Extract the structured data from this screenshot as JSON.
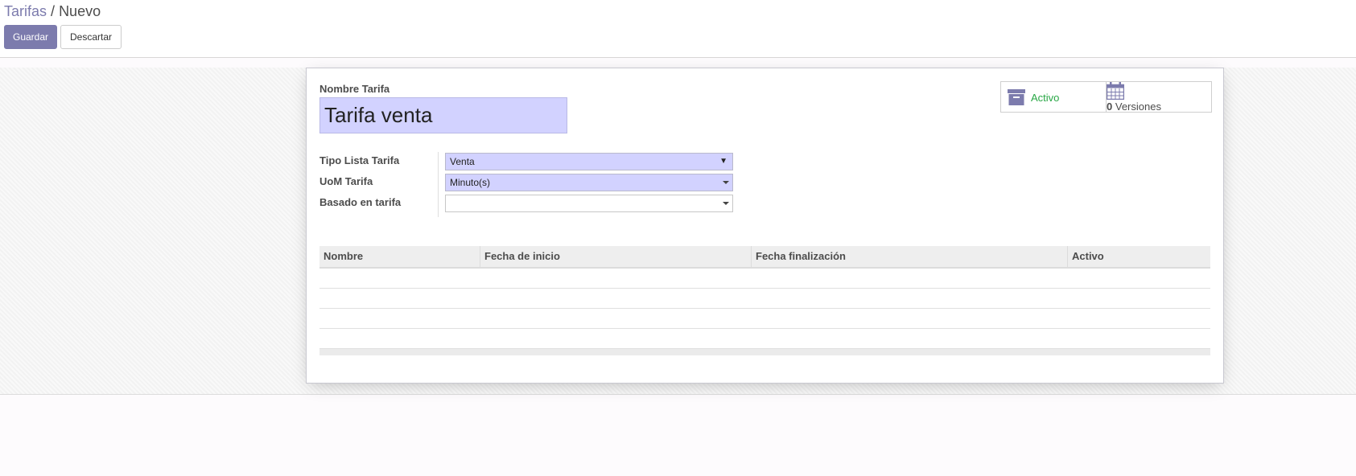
{
  "breadcrumb": {
    "parent": "Tarifas",
    "separator": "/",
    "current": "Nuevo"
  },
  "toolbar": {
    "save_label": "Guardar",
    "discard_label": "Descartar"
  },
  "form": {
    "name_label": "Nombre Tarifa",
    "name_value": "Tarifa venta",
    "smart_buttons": {
      "active_label": "Activo",
      "active_icon": "archive-icon",
      "versions_count": "0",
      "versions_label": "Versiones",
      "versions_icon": "calendar-icon"
    },
    "fields": [
      {
        "label": "Tipo Lista Tarifa",
        "value": "Venta"
      },
      {
        "label": "UoM Tarifa",
        "value": "Minuto(s)"
      },
      {
        "label": "Basado en tarifa",
        "value": ""
      }
    ],
    "table": {
      "columns": [
        "Nombre",
        "Fecha de inicio",
        "Fecha finalización",
        "Activo"
      ],
      "rows": []
    }
  },
  "colors": {
    "primary": "#7c7bad",
    "required_field": "#d2d2ff",
    "active_green": "#28a745"
  }
}
